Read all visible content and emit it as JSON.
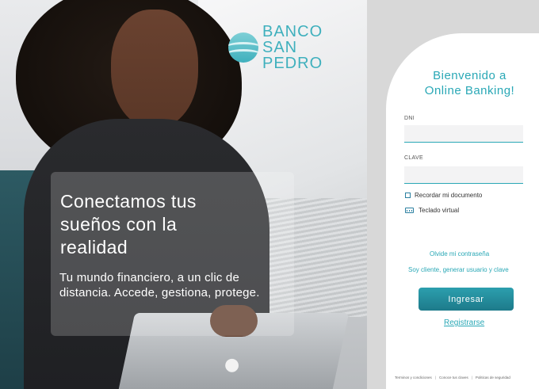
{
  "brand": {
    "line1": "BANCO",
    "line2": "SAN",
    "line3": "PEDRO",
    "color": "#3fb0bd"
  },
  "hero": {
    "headline_line1": "Conectamos tus",
    "headline_line2": "sueños con la",
    "headline_line3": "realidad",
    "body": "Tu mundo financiero, a un clic de distancia. Accede, gestiona, protege."
  },
  "login": {
    "welcome_line1": "Bienvenido a",
    "welcome_line2": "Online Banking!",
    "dni_label": "DNI",
    "dni_value": "",
    "clave_label": "CLAVE",
    "clave_value": "",
    "remember_label": "Recordar mi documento",
    "keyboard_label": "Teclado virtual",
    "forgot_link": "Olvide mi contraseña",
    "create_user_link": "Soy cliente, generar usuario y clave",
    "submit_label": "Ingresar",
    "register_link": "Registrarse",
    "accent_color": "#2aa8b6"
  },
  "footer": {
    "links": [
      "Terminos y condiciones",
      "Conoce tus claves",
      "Politicas de seguridad"
    ],
    "separator": "|"
  },
  "icons": {
    "brand_mark": "waves-circle-logo",
    "keyboard": "keyboard-icon",
    "checkbox": "checkbox-icon"
  }
}
